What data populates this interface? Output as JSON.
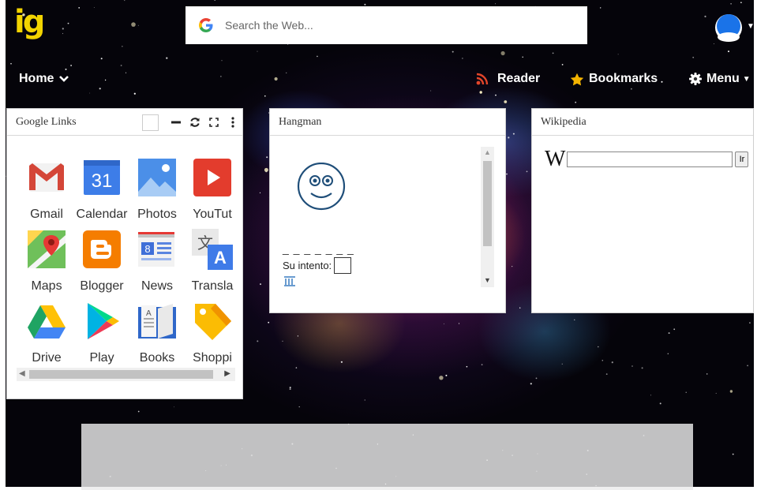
{
  "header": {
    "logo_text": "ig",
    "search_placeholder": "Search the Web...",
    "search_icon": "google-g-icon",
    "avatar_icon": "user-avatar-icon"
  },
  "nav": {
    "home": "Home",
    "reader": "Reader",
    "bookmarks": "Bookmarks",
    "menu": "Menu"
  },
  "widgets": {
    "google_links": {
      "title": "Google Links",
      "apps": [
        {
          "name": "Gmail",
          "icon": "gmail-icon"
        },
        {
          "name": "Calendar",
          "icon": "calendar-icon",
          "badge": "31"
        },
        {
          "name": "Photos",
          "icon": "photos-icon"
        },
        {
          "name": "YouTut",
          "icon": "youtube-icon"
        },
        {
          "name": "Maps",
          "icon": "maps-icon"
        },
        {
          "name": "Blogger",
          "icon": "blogger-icon"
        },
        {
          "name": "News",
          "icon": "news-icon"
        },
        {
          "name": "Transla",
          "icon": "translate-icon"
        },
        {
          "name": "Drive",
          "icon": "drive-icon"
        },
        {
          "name": "Play",
          "icon": "play-icon"
        },
        {
          "name": "Books",
          "icon": "books-icon"
        },
        {
          "name": "Shoppi",
          "icon": "shopping-icon"
        }
      ]
    },
    "hangman": {
      "title": "Hangman",
      "word_blanks": "_ _ _ _ _ _ _",
      "guess_label": "Su intento:"
    },
    "wikipedia": {
      "title": "Wikipedia",
      "logo": "W",
      "go_button": "Ir"
    }
  },
  "colors": {
    "logo_yellow": "#f2d400",
    "bookmark_star": "#f4b400",
    "reader_rss": "#e2452a",
    "avatar_blue": "#1a73e8"
  }
}
